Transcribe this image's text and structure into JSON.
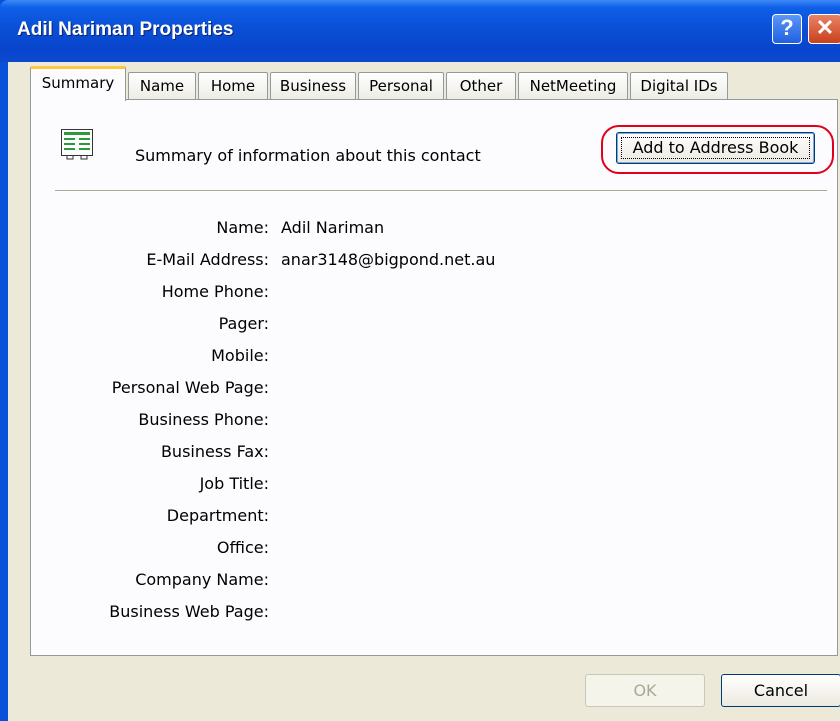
{
  "window": {
    "title": "Adil Nariman Properties"
  },
  "titlebar": {
    "help_glyph": "?",
    "close_glyph": "✕"
  },
  "tabs": [
    {
      "label": "Summary",
      "active": true
    },
    {
      "label": "Name"
    },
    {
      "label": "Home"
    },
    {
      "label": "Business"
    },
    {
      "label": "Personal"
    },
    {
      "label": "Other"
    },
    {
      "label": "NetMeeting"
    },
    {
      "label": "Digital IDs"
    }
  ],
  "summary": {
    "intro": "Summary of information about this contact",
    "add_button": "Add to Address Book",
    "icon": "contact-card-icon",
    "fields": [
      {
        "label": "Name:",
        "value": "Adil Nariman"
      },
      {
        "label": "E-Mail Address:",
        "value": "anar3148@bigpond.net.au"
      },
      {
        "label": "Home Phone:",
        "value": ""
      },
      {
        "label": "Pager:",
        "value": ""
      },
      {
        "label": "Mobile:",
        "value": ""
      },
      {
        "label": "Personal Web Page:",
        "value": ""
      },
      {
        "label": "Business Phone:",
        "value": ""
      },
      {
        "label": "Business Fax:",
        "value": ""
      },
      {
        "label": "Job Title:",
        "value": ""
      },
      {
        "label": "Department:",
        "value": ""
      },
      {
        "label": "Office:",
        "value": ""
      },
      {
        "label": "Company Name:",
        "value": ""
      },
      {
        "label": "Business Web Page:",
        "value": ""
      }
    ]
  },
  "footer": {
    "ok": "OK",
    "cancel": "Cancel",
    "ok_enabled": false
  },
  "colors": {
    "titlebar": "#0a4fd6",
    "highlight_ring": "#e0001a",
    "tab_active_accent": "#ffc83c"
  }
}
